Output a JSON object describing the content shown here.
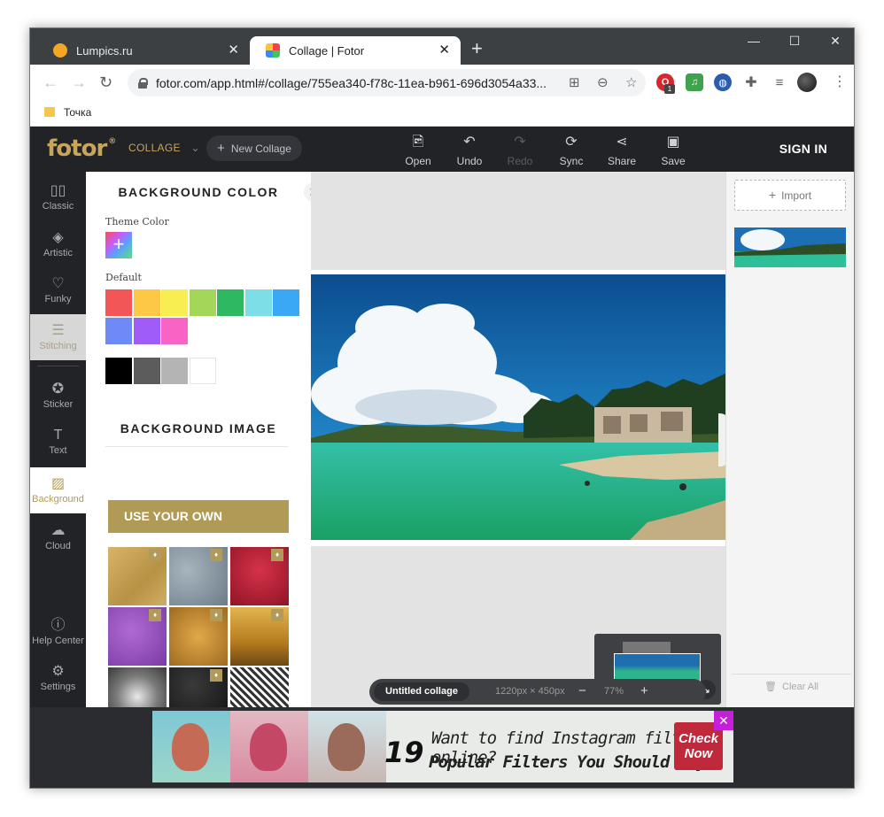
{
  "browser": {
    "tabs": [
      {
        "title": "Lumpics.ru",
        "close": "✕"
      },
      {
        "title": "Collage | Fotor",
        "close": "✕"
      }
    ],
    "new_tab": "+",
    "window_controls": {
      "minimize": "—",
      "maximize": "☐",
      "close": "✕"
    },
    "url": "fotor.com/app.html#/collage/755ea340-f78c-11ea-b961-696d3054a33...",
    "bookmark": "Точка",
    "extension_badge": "1",
    "menu": "⋮"
  },
  "header": {
    "logo": "fotor",
    "logo_mark": "®",
    "mode": "COLLAGE",
    "new_collage": "New Collage",
    "tools": [
      {
        "label": "Open",
        "icon": "open-icon"
      },
      {
        "label": "Undo",
        "icon": "undo-icon"
      },
      {
        "label": "Redo",
        "icon": "redo-icon",
        "disabled": true
      },
      {
        "label": "Sync",
        "icon": "sync-icon"
      },
      {
        "label": "Share",
        "icon": "share-icon"
      },
      {
        "label": "Save",
        "icon": "save-icon"
      }
    ],
    "sign_in": "SIGN IN"
  },
  "nav": {
    "items": [
      {
        "label": "Classic"
      },
      {
        "label": "Artistic"
      },
      {
        "label": "Funky"
      },
      {
        "label": "Stitching"
      },
      {
        "label": "Sticker"
      },
      {
        "label": "Text"
      },
      {
        "label": "Background"
      },
      {
        "label": "Cloud"
      },
      {
        "label": "Help Center"
      },
      {
        "label": "Settings"
      }
    ],
    "active": "Background"
  },
  "panel": {
    "title": "BACKGROUND COLOR",
    "theme_label": "Theme Color",
    "theme_add": "+",
    "default_label": "Default",
    "swatches": [
      "#f35656",
      "#fdc843",
      "#f8ee52",
      "#a4d65a",
      "#2fb862",
      "#7ddee8",
      "#3aa8f5",
      "#6e8af7",
      "#a05cf6",
      "#f864c3"
    ],
    "swatches_gray": [
      "#000000",
      "#5c5c5c",
      "#b4b4b4",
      "#ffffff"
    ],
    "image_title": "BACKGROUND IMAGE",
    "use_own": "USE YOUR OWN",
    "close": "✕"
  },
  "canvas": {
    "collage_name": "Untitled collage",
    "size": "1220px × 450px",
    "zoom": "77%",
    "zoom_minus": "−",
    "zoom_plus": "+"
  },
  "right": {
    "import": "Import",
    "clear_all": "Clear All"
  },
  "ad": {
    "number": "19",
    "line1": "Want to find Instagram filters online?",
    "line2": "Popular Filters You Should Try",
    "cta": "Check Now",
    "close": "✕"
  }
}
